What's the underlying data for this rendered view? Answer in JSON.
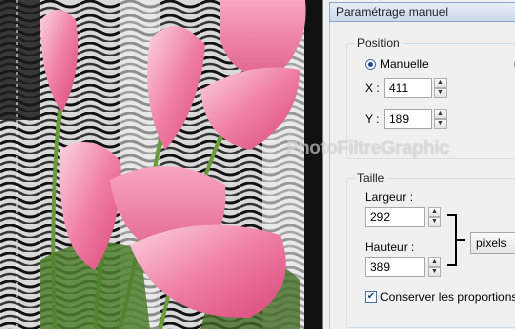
{
  "canvas": {
    "watermark": "PhotoFiltreGraphic"
  },
  "dialog": {
    "title": "Paramétrage manuel",
    "position": {
      "group_label": "Position",
      "radio_label": "Manuelle",
      "x_label": "X :",
      "x_value": "411",
      "y_label": "Y :",
      "y_value": "189"
    },
    "size": {
      "group_label": "Taille",
      "width_label": "Largeur :",
      "width_value": "292",
      "height_label": "Hauteur :",
      "height_value": "389",
      "unit_selected": "pixels",
      "keep_proportions_label": "Conserver les proportions",
      "keep_proportions_checked": true
    }
  }
}
